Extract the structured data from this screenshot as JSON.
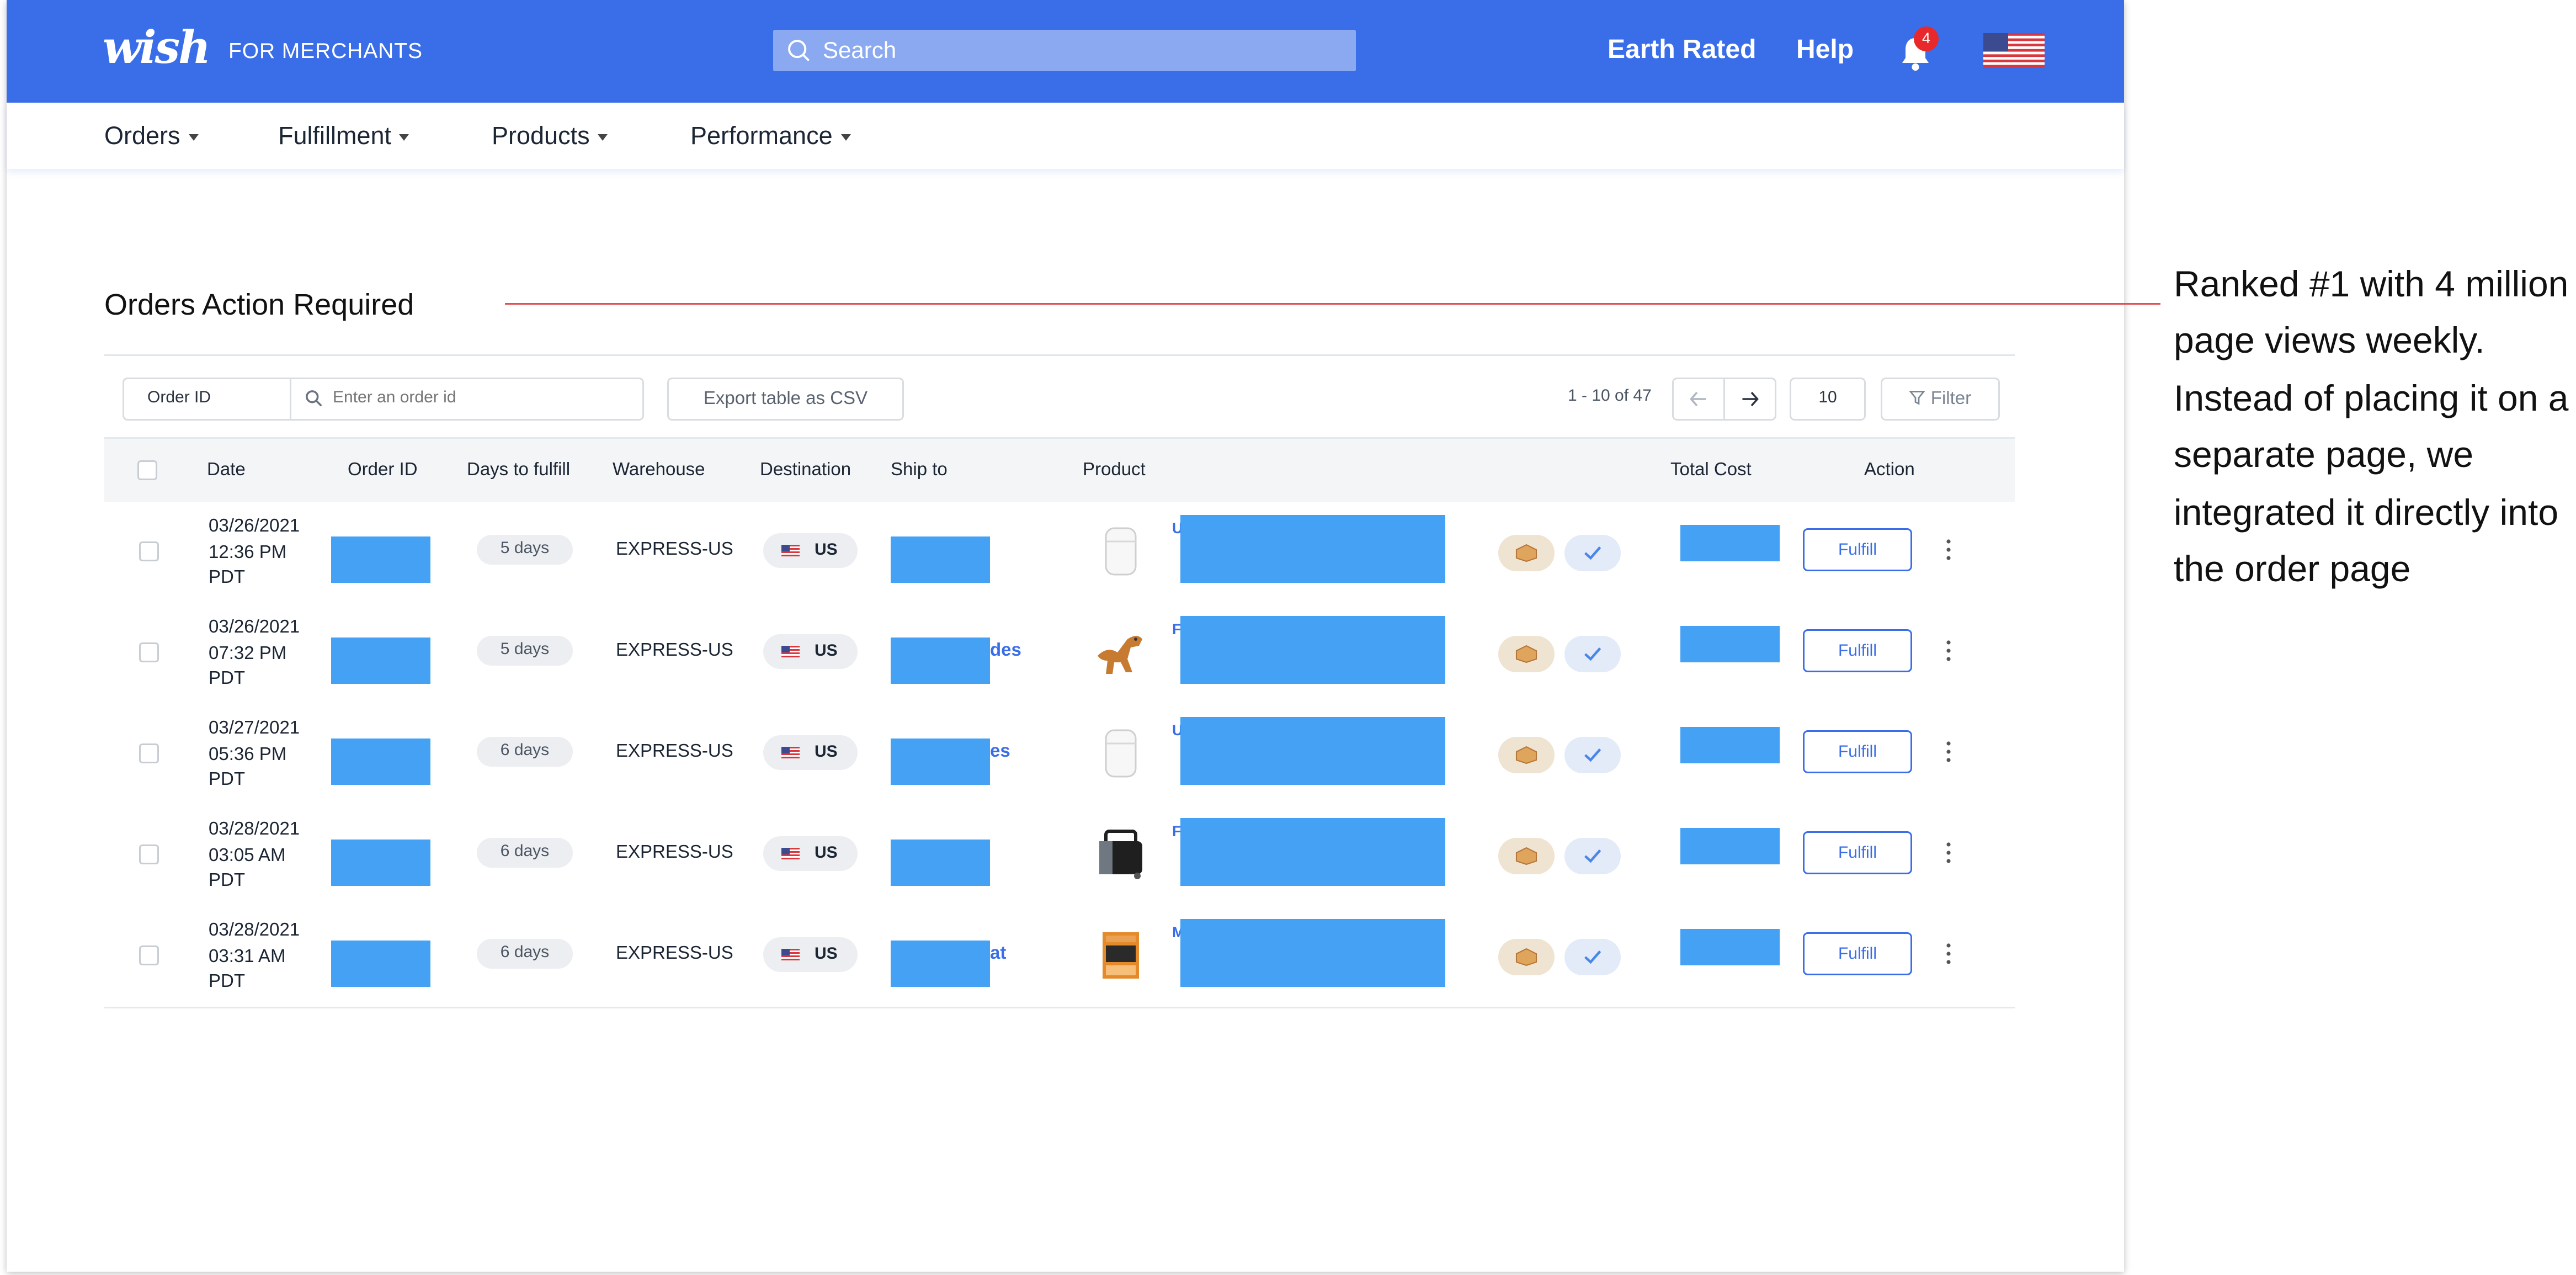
{
  "header": {
    "logo": "wish",
    "logo_sub": "FOR MERCHANTS",
    "search_placeholder": "Search",
    "store_name": "Earth Rated",
    "help": "Help",
    "notification_count": "4",
    "colors": {
      "bar": "#3a6ee8",
      "badge": "#e8282a"
    },
    "icons": [
      "search-icon",
      "bell-icon",
      "us-flag-icon"
    ]
  },
  "nav": [
    {
      "label": "Orders"
    },
    {
      "label": "Fulfillment"
    },
    {
      "label": "Products"
    },
    {
      "label": "Performance"
    }
  ],
  "section": {
    "title": "Orders Action Required"
  },
  "toolbar": {
    "filter_field": "Order ID",
    "search_placeholder": "Enter an order id",
    "export_label": "Export table as CSV",
    "range_text": "1 - 10 of 47",
    "page_size": "10",
    "filter_label": "Filter"
  },
  "table": {
    "headers": {
      "date": "Date",
      "order_id": "Order ID",
      "days": "Days to fulfill",
      "warehouse": "Warehouse",
      "destination": "Destination",
      "ship_to": "Ship to",
      "product": "Product",
      "total_cost": "Total Cost",
      "action": "Action"
    },
    "rows": [
      {
        "date_line1": "03/26/2021",
        "date_line2": "12:36 PM",
        "date_line3": "PDT",
        "days": "5 days",
        "warehouse": "EXPRESS-US",
        "destination": "US",
        "ship_fragment": "",
        "product_char": "U",
        "product_icon": "airpods-case-image",
        "action": "Fulfill"
      },
      {
        "date_line1": "03/26/2021",
        "date_line2": "07:32 PM",
        "date_line3": "PDT",
        "days": "5 days",
        "warehouse": "EXPRESS-US",
        "destination": "US",
        "ship_fragment": "des",
        "product_char": "F",
        "product_icon": "dinosaur-toy-image",
        "action": "Fulfill"
      },
      {
        "date_line1": "03/27/2021",
        "date_line2": "05:36 PM",
        "date_line3": "PDT",
        "days": "6 days",
        "warehouse": "EXPRESS-US",
        "destination": "US",
        "ship_fragment": "es",
        "product_char": "U",
        "product_icon": "airpods-case-image",
        "action": "Fulfill"
      },
      {
        "date_line1": "03/28/2021",
        "date_line2": "03:05 AM",
        "date_line3": "PDT",
        "days": "6 days",
        "warehouse": "EXPRESS-US",
        "destination": "US",
        "ship_fragment": "",
        "product_char": "F",
        "product_icon": "cooler-bag-image",
        "action": "Fulfill"
      },
      {
        "date_line1": "03/28/2021",
        "date_line2": "03:31 AM",
        "date_line3": "PDT",
        "days": "6 days",
        "warehouse": "EXPRESS-US",
        "destination": "US",
        "ship_fragment": "at",
        "product_char": "M",
        "product_icon": "boxed-product-image",
        "action": "Fulfill"
      }
    ],
    "redaction_color": "#44a1f4"
  },
  "annotation": {
    "text": "Ranked #1 with 4 million page views weekly. Instead of placing it on a separate page, we integrated it directly into the order page",
    "line_color": "#e35050"
  }
}
